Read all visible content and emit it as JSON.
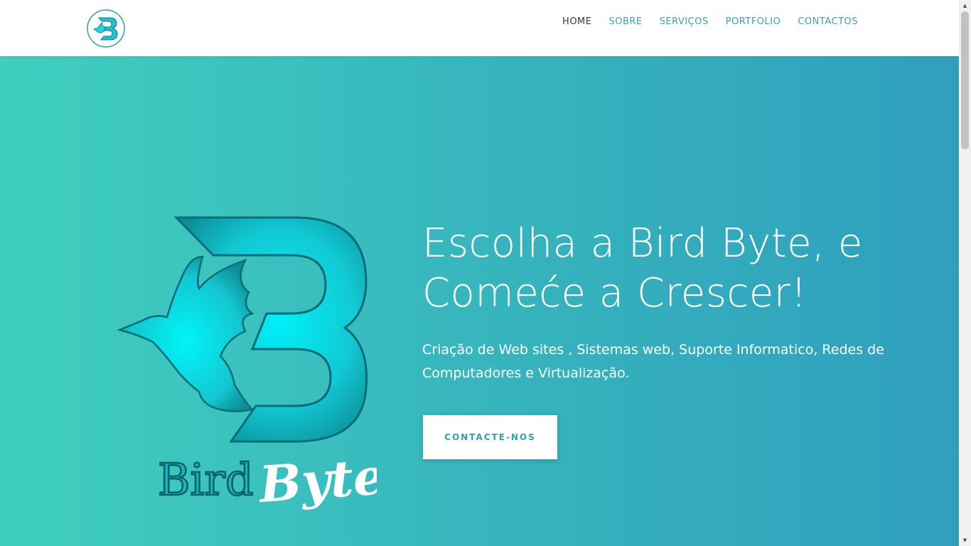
{
  "header": {
    "logo_alt": "Bird Byte logo",
    "nav": [
      {
        "label": "HOME",
        "active": true
      },
      {
        "label": "SOBRE",
        "active": false
      },
      {
        "label": "SERVIÇOS",
        "active": false
      },
      {
        "label": "PORTFOLIO",
        "active": false
      },
      {
        "label": "CONTACTOS",
        "active": false
      }
    ]
  },
  "hero": {
    "logo_text_bird": "Bird",
    "logo_text_byte": "Byte",
    "headline_line1": "Escolha a Bird Byte, e",
    "headline_line2": "Comeće a Crescer!",
    "subtitle": "Criação de Web sites , Sistemas web, Suporte Informatico, Redes de Computadores e Virtualização.",
    "cta_label": "CONTACTE-NOS"
  },
  "colors": {
    "gradient_start": "#3fcfbe",
    "gradient_end": "#2f9fbd",
    "accent": "#3aa3a8",
    "logo_cyan": "#00e5f0"
  }
}
